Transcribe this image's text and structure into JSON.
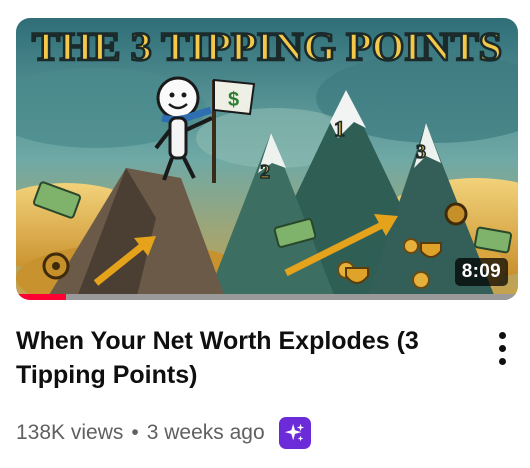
{
  "video": {
    "thumbnail": {
      "headline": "THE 3 TIPPING POINTS",
      "peak_labels": [
        "1",
        "2",
        "3"
      ],
      "flag_symbol": "$"
    },
    "duration": "8:09",
    "watch_progress_percent": 10,
    "title": "When Your Net Worth Explodes (3 Tipping Points)",
    "views": "138K views",
    "separator": "•",
    "uploaded": "3 weeks ago",
    "badge_icon": "sparkle-icon",
    "menu_icon": "more-vert-icon"
  },
  "colors": {
    "progress": "#ff0033",
    "badge": "#6b2bd9",
    "title_text": "#0f0f0f",
    "meta_text": "#606060"
  }
}
